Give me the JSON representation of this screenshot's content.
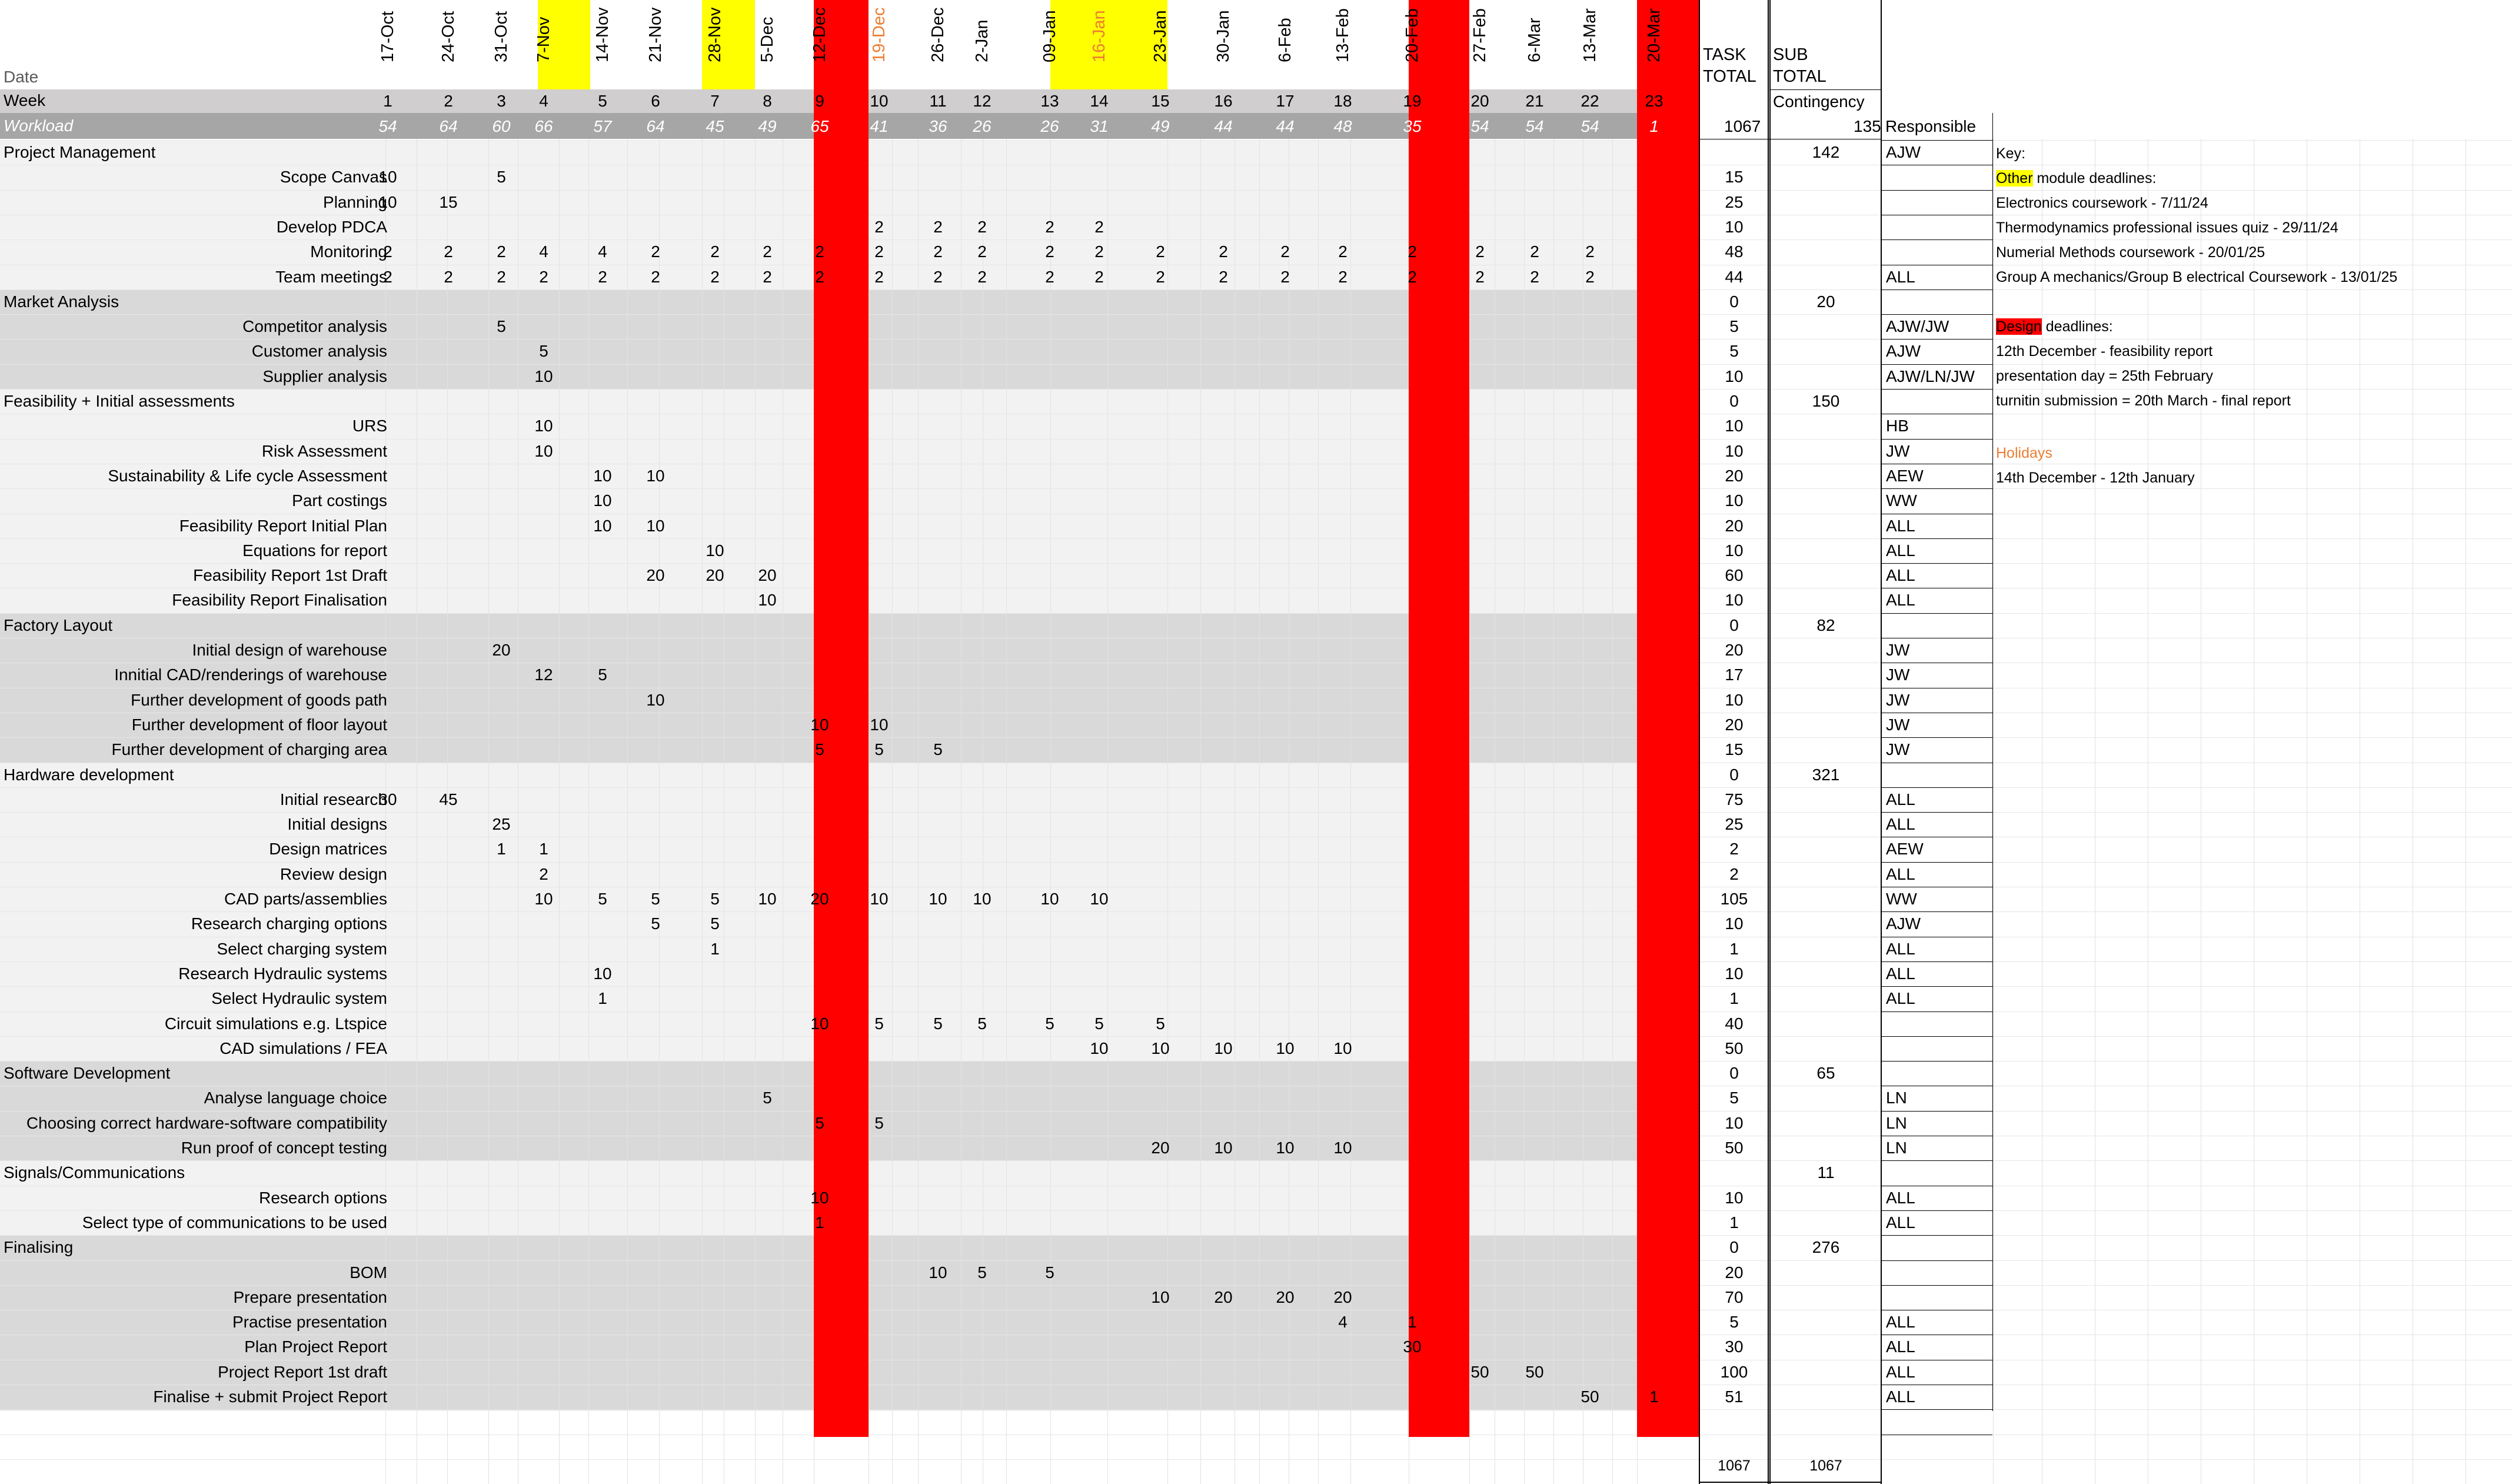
{
  "labels": {
    "date": "Date",
    "week": "Week",
    "workload": "Workload",
    "task_total": [
      "TASK",
      "TOTAL"
    ],
    "sub_total": [
      "SUB",
      "TOTAL"
    ],
    "contingency": "Contingency",
    "contingency_value": "135",
    "responsible": "Responsible",
    "workload_total": "1067"
  },
  "colors": {
    "holiday_column": "#ff0000",
    "other_deadline": "#ffff00",
    "holiday_text": "#ed7d31",
    "section_shade": "#d9d9d9",
    "light_shade": "#f2f2f2",
    "week_band": "#d0cece",
    "workload_band": "#a6a6a6"
  },
  "weeks": [
    {
      "date": "17-Oct",
      "week": "1",
      "load": "54"
    },
    {
      "date": "24-Oct",
      "week": "2",
      "load": "64"
    },
    {
      "date": "31-Oct",
      "week": "3",
      "load": "60"
    },
    {
      "date": "7-Nov",
      "week": "4",
      "load": "66",
      "mark": "yellow"
    },
    {
      "date": "14-Nov",
      "week": "5",
      "load": "57"
    },
    {
      "date": "21-Nov",
      "week": "6",
      "load": "64"
    },
    {
      "date": "28-Nov",
      "week": "7",
      "load": "45",
      "mark": "yellow"
    },
    {
      "date": "5-Dec",
      "week": "8",
      "load": "49"
    },
    {
      "date": "12-Dec",
      "week": "9",
      "load": "65",
      "mark": "red"
    },
    {
      "date": "19-Dec",
      "week": "10",
      "load": "41",
      "mark": "orange"
    },
    {
      "date": "26-Dec",
      "week": "11",
      "load": "36"
    },
    {
      "date": "2-Jan",
      "week": "12",
      "load": "26"
    },
    {
      "date": "09-Jan",
      "week": "13",
      "load": "26",
      "mark": "yellow"
    },
    {
      "date": "16-Jan",
      "week": "14",
      "load": "31",
      "mark": "yelloworange"
    },
    {
      "date": "23-Jan",
      "week": "15",
      "load": "49"
    },
    {
      "date": "30-Jan",
      "week": "16",
      "load": "44"
    },
    {
      "date": "6-Feb",
      "week": "17",
      "load": "44"
    },
    {
      "date": "13-Feb",
      "week": "18",
      "load": "48"
    },
    {
      "date": "20-Feb",
      "week": "19",
      "load": "35",
      "mark": "red"
    },
    {
      "date": "27-Feb",
      "week": "20",
      "load": "54"
    },
    {
      "date": "6-Mar",
      "week": "21",
      "load": "54"
    },
    {
      "date": "13-Mar",
      "week": "22",
      "load": "54"
    },
    {
      "date": "20-Mar",
      "week": "23",
      "load": "1",
      "mark": "red"
    }
  ],
  "rows": [
    {
      "type": "section",
      "label": "Project Management",
      "total": "",
      "sub": "142",
      "resp": "AJW",
      "shade": "light"
    },
    {
      "label": "Scope Canvas",
      "cells": {
        "0": "10",
        "2": "5"
      },
      "total": "15",
      "resp": "",
      "shade": "light"
    },
    {
      "label": "Planning",
      "cells": {
        "0": "10",
        "1": "15"
      },
      "total": "25",
      "resp": "",
      "shade": "light"
    },
    {
      "label": "Develop PDCA",
      "cells": {
        "9": "2",
        "10": "2",
        "11": "2",
        "12": "2",
        "13": "2"
      },
      "total": "10",
      "resp": "",
      "shade": "light"
    },
    {
      "label": "Monitoring",
      "cells": {
        "0": "2",
        "1": "2",
        "2": "2",
        "3": "4",
        "4": "4",
        "5": "2",
        "6": "2",
        "7": "2",
        "8": "2",
        "9": "2",
        "10": "2",
        "11": "2",
        "12": "2",
        "13": "2",
        "14": "2",
        "15": "2",
        "16": "2",
        "17": "2",
        "18": "2",
        "19": "2",
        "20": "2",
        "21": "2"
      },
      "total": "48",
      "resp": "",
      "shade": "light"
    },
    {
      "label": "Team meetings",
      "cells": {
        "0": "2",
        "1": "2",
        "2": "2",
        "3": "2",
        "4": "2",
        "5": "2",
        "6": "2",
        "7": "2",
        "8": "2",
        "9": "2",
        "10": "2",
        "11": "2",
        "12": "2",
        "13": "2",
        "14": "2",
        "15": "2",
        "16": "2",
        "17": "2",
        "18": "2",
        "19": "2",
        "20": "2",
        "21": "2"
      },
      "total": "44",
      "resp": "ALL",
      "shade": "light"
    },
    {
      "type": "section",
      "label": "Market Analysis",
      "total": "0",
      "sub": "20",
      "resp": "",
      "shade": "dark"
    },
    {
      "label": "Competitor analysis",
      "cells": {
        "2": "5"
      },
      "total": "5",
      "resp": "AJW/JW",
      "shade": "dark"
    },
    {
      "label": "Customer analysis",
      "cells": {
        "3": "5"
      },
      "total": "5",
      "resp": "AJW",
      "shade": "dark"
    },
    {
      "label": "Supplier analysis",
      "cells": {
        "3": "10"
      },
      "total": "10",
      "resp": "AJW/LN/JW",
      "shade": "dark"
    },
    {
      "type": "section",
      "label": "Feasibility + Initial assessments",
      "total": "0",
      "sub": "150",
      "resp": "",
      "shade": "light"
    },
    {
      "label": "URS",
      "cells": {
        "3": "10"
      },
      "total": "10",
      "resp": "HB",
      "shade": "light"
    },
    {
      "label": "Risk Assessment",
      "cells": {
        "3": "10"
      },
      "total": "10",
      "resp": "JW",
      "shade": "light"
    },
    {
      "label": "Sustainability & Life cycle Assessment",
      "cells": {
        "4": "10",
        "5": "10"
      },
      "total": "20",
      "resp": "AEW",
      "shade": "light"
    },
    {
      "label": "Part costings",
      "cells": {
        "4": "10"
      },
      "total": "10",
      "resp": "WW",
      "shade": "light"
    },
    {
      "label": "Feasibility Report Initial Plan",
      "cells": {
        "4": "10",
        "5": "10"
      },
      "total": "20",
      "resp": "ALL",
      "shade": "light"
    },
    {
      "label": "Equations for report",
      "cells": {
        "6": "10"
      },
      "total": "10",
      "resp": "ALL",
      "shade": "light"
    },
    {
      "label": "Feasibility Report 1st Draft",
      "cells": {
        "5": "20",
        "6": "20",
        "7": "20"
      },
      "total": "60",
      "resp": "ALL",
      "shade": "light"
    },
    {
      "label": "Feasibility Report Finalisation",
      "cells": {
        "7": "10"
      },
      "total": "10",
      "resp": "ALL",
      "shade": "light"
    },
    {
      "type": "section",
      "label": "Factory Layout",
      "total": "0",
      "sub": "82",
      "resp": "",
      "shade": "dark"
    },
    {
      "label": "Initial design of warehouse",
      "cells": {
        "2": "20"
      },
      "total": "20",
      "resp": "JW",
      "shade": "dark"
    },
    {
      "label": "Innitial CAD/renderings of warehouse",
      "cells": {
        "3": "12",
        "4": "5"
      },
      "total": "17",
      "resp": "JW",
      "shade": "dark"
    },
    {
      "label": "Further development of goods path",
      "cells": {
        "5": "10"
      },
      "total": "10",
      "resp": "JW",
      "shade": "dark"
    },
    {
      "label": "Further development of floor layout",
      "cells": {
        "8": "10",
        "9": "10"
      },
      "total": "20",
      "resp": "JW",
      "shade": "dark"
    },
    {
      "label": "Further development of charging area",
      "cells": {
        "8": "5",
        "9": "5",
        "10": "5"
      },
      "total": "15",
      "resp": "JW",
      "shade": "dark"
    },
    {
      "type": "section",
      "label": "Hardware development",
      "total": "0",
      "sub": "321",
      "resp": "",
      "shade": "light"
    },
    {
      "label": "Initial research",
      "cells": {
        "0": "30",
        "1": "45"
      },
      "total": "75",
      "resp": "ALL",
      "shade": "light"
    },
    {
      "label": "Initial designs",
      "cells": {
        "2": "25"
      },
      "total": "25",
      "resp": "ALL",
      "shade": "light"
    },
    {
      "label": "Design matrices",
      "cells": {
        "2": "1",
        "3": "1"
      },
      "total": "2",
      "resp": "AEW",
      "shade": "light"
    },
    {
      "label": "Review design",
      "cells": {
        "3": "2"
      },
      "total": "2",
      "resp": "ALL",
      "shade": "light"
    },
    {
      "label": "CAD parts/assemblies",
      "cells": {
        "3": "10",
        "4": "5",
        "5": "5",
        "6": "5",
        "7": "10",
        "8": "20",
        "9": "10",
        "10": "10",
        "11": "10",
        "12": "10",
        "13": "10"
      },
      "total": "105",
      "resp": "WW",
      "shade": "light"
    },
    {
      "label": "Research charging options",
      "cells": {
        "5": "5",
        "6": "5"
      },
      "total": "10",
      "resp": "AJW",
      "shade": "light"
    },
    {
      "label": "Select charging system",
      "cells": {
        "6": "1"
      },
      "total": "1",
      "resp": "ALL",
      "shade": "light"
    },
    {
      "label": "Research Hydraulic systems",
      "cells": {
        "4": "10"
      },
      "total": "10",
      "resp": "ALL",
      "shade": "light"
    },
    {
      "label": "Select Hydraulic system",
      "cells": {
        "4": "1"
      },
      "total": "1",
      "resp": "ALL",
      "shade": "light"
    },
    {
      "label": "Circuit simulations e.g. Ltspice",
      "cells": {
        "8": "10",
        "9": "5",
        "10": "5",
        "11": "5",
        "12": "5",
        "13": "5",
        "14": "5"
      },
      "total": "40",
      "resp": "",
      "shade": "light"
    },
    {
      "label": "CAD simulations / FEA",
      "cells": {
        "13": "10",
        "14": "10",
        "15": "10",
        "16": "10",
        "17": "10"
      },
      "total": "50",
      "resp": "",
      "shade": "light"
    },
    {
      "type": "section",
      "label": "Software Development",
      "total": "0",
      "sub": "65",
      "resp": "",
      "shade": "dark"
    },
    {
      "label": "Analyse language choice",
      "cells": {
        "7": "5"
      },
      "total": "5",
      "resp": "LN",
      "shade": "dark"
    },
    {
      "label": "Choosing correct hardware-software compatibility",
      "cells": {
        "8": "5",
        "9": "5"
      },
      "total": "10",
      "resp": "LN",
      "shade": "dark"
    },
    {
      "label": "Run proof of concept testing",
      "cells": {
        "14": "20",
        "15": "10",
        "16": "10",
        "17": "10"
      },
      "total": "50",
      "resp": "LN",
      "shade": "dark"
    },
    {
      "type": "section",
      "label": "Signals/Communications",
      "total": "",
      "sub": "11",
      "resp": "",
      "shade": "light"
    },
    {
      "label": "Research options",
      "cells": {
        "8": "10"
      },
      "total": "10",
      "resp": "ALL",
      "shade": "light"
    },
    {
      "label": "Select type of communications to be used",
      "cells": {
        "8": "1"
      },
      "total": "1",
      "resp": "ALL",
      "shade": "light"
    },
    {
      "type": "section",
      "label": "Finalising",
      "total": "0",
      "sub": "276",
      "resp": "",
      "shade": "dark"
    },
    {
      "label": "BOM",
      "cells": {
        "10": "10",
        "11": "5",
        "12": "5"
      },
      "total": "20",
      "resp": "",
      "shade": "dark"
    },
    {
      "label": "Prepare presentation",
      "cells": {
        "14": "10",
        "15": "20",
        "16": "20",
        "17": "20"
      },
      "total": "70",
      "resp": "",
      "shade": "dark"
    },
    {
      "label": "Practise presentation",
      "cells": {
        "17": "4",
        "18": "1"
      },
      "total": "5",
      "resp": "ALL",
      "shade": "dark"
    },
    {
      "label": "Plan Project Report",
      "cells": {
        "18": "30"
      },
      "total": "30",
      "resp": "ALL",
      "shade": "dark"
    },
    {
      "label": "Project Report 1st draft",
      "cells": {
        "19": "50",
        "20": "50"
      },
      "total": "100",
      "resp": "ALL",
      "shade": "dark"
    },
    {
      "label": "Finalise + submit Project Report",
      "cells": {
        "21": "50",
        "22": "1"
      },
      "total": "51",
      "resp": "ALL",
      "shade": "dark"
    }
  ],
  "totals": {
    "task": "1067",
    "sub": "1067"
  },
  "key": {
    "title": "Key:",
    "other_word": "Other",
    "other_rest": " module deadlines:",
    "other_items": [
      "Electronics coursework - 7/11/24",
      "Thermodynamics professional issues quiz - 29/11/24",
      "Numerial Methods coursework - 20/01/25",
      "Group A mechanics/Group B electrical Coursework - 13/01/25"
    ],
    "design_word": "Design",
    "design_rest": " deadlines:",
    "design_items": [
      "12th December - feasibility report",
      "presentation day = 25th February",
      "turnitin submission = 20th March - final report"
    ],
    "holidays_title": "Holidays",
    "holidays_item": "14th December - 12th January"
  }
}
